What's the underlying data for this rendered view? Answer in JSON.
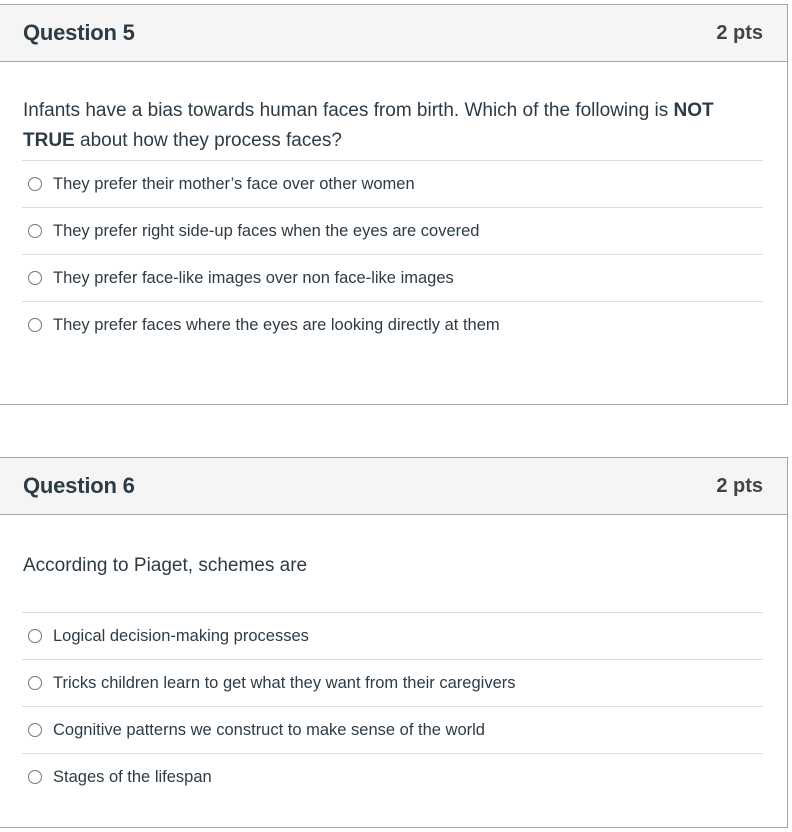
{
  "questions": [
    {
      "title": "Question 5",
      "points": "2 pts",
      "text_parts": [
        "Infants have a bias towards human faces from birth. Which of the following is ",
        "NOT TRUE",
        " about how they process faces?"
      ],
      "answers": [
        "They prefer their mother’s face over other women",
        "They prefer right side-up faces when the eyes are covered",
        "They prefer face-like images over non face-like images",
        "They prefer faces where the eyes are looking directly at them"
      ]
    },
    {
      "title": "Question 6",
      "points": "2 pts",
      "text_parts": [
        "According to Piaget, schemes are"
      ],
      "answers": [
        "Logical decision-making processes",
        "Tricks children learn to get what they want from their caregivers",
        "Cognitive patterns we construct to make sense of the world",
        "Stages of the lifespan"
      ]
    }
  ]
}
